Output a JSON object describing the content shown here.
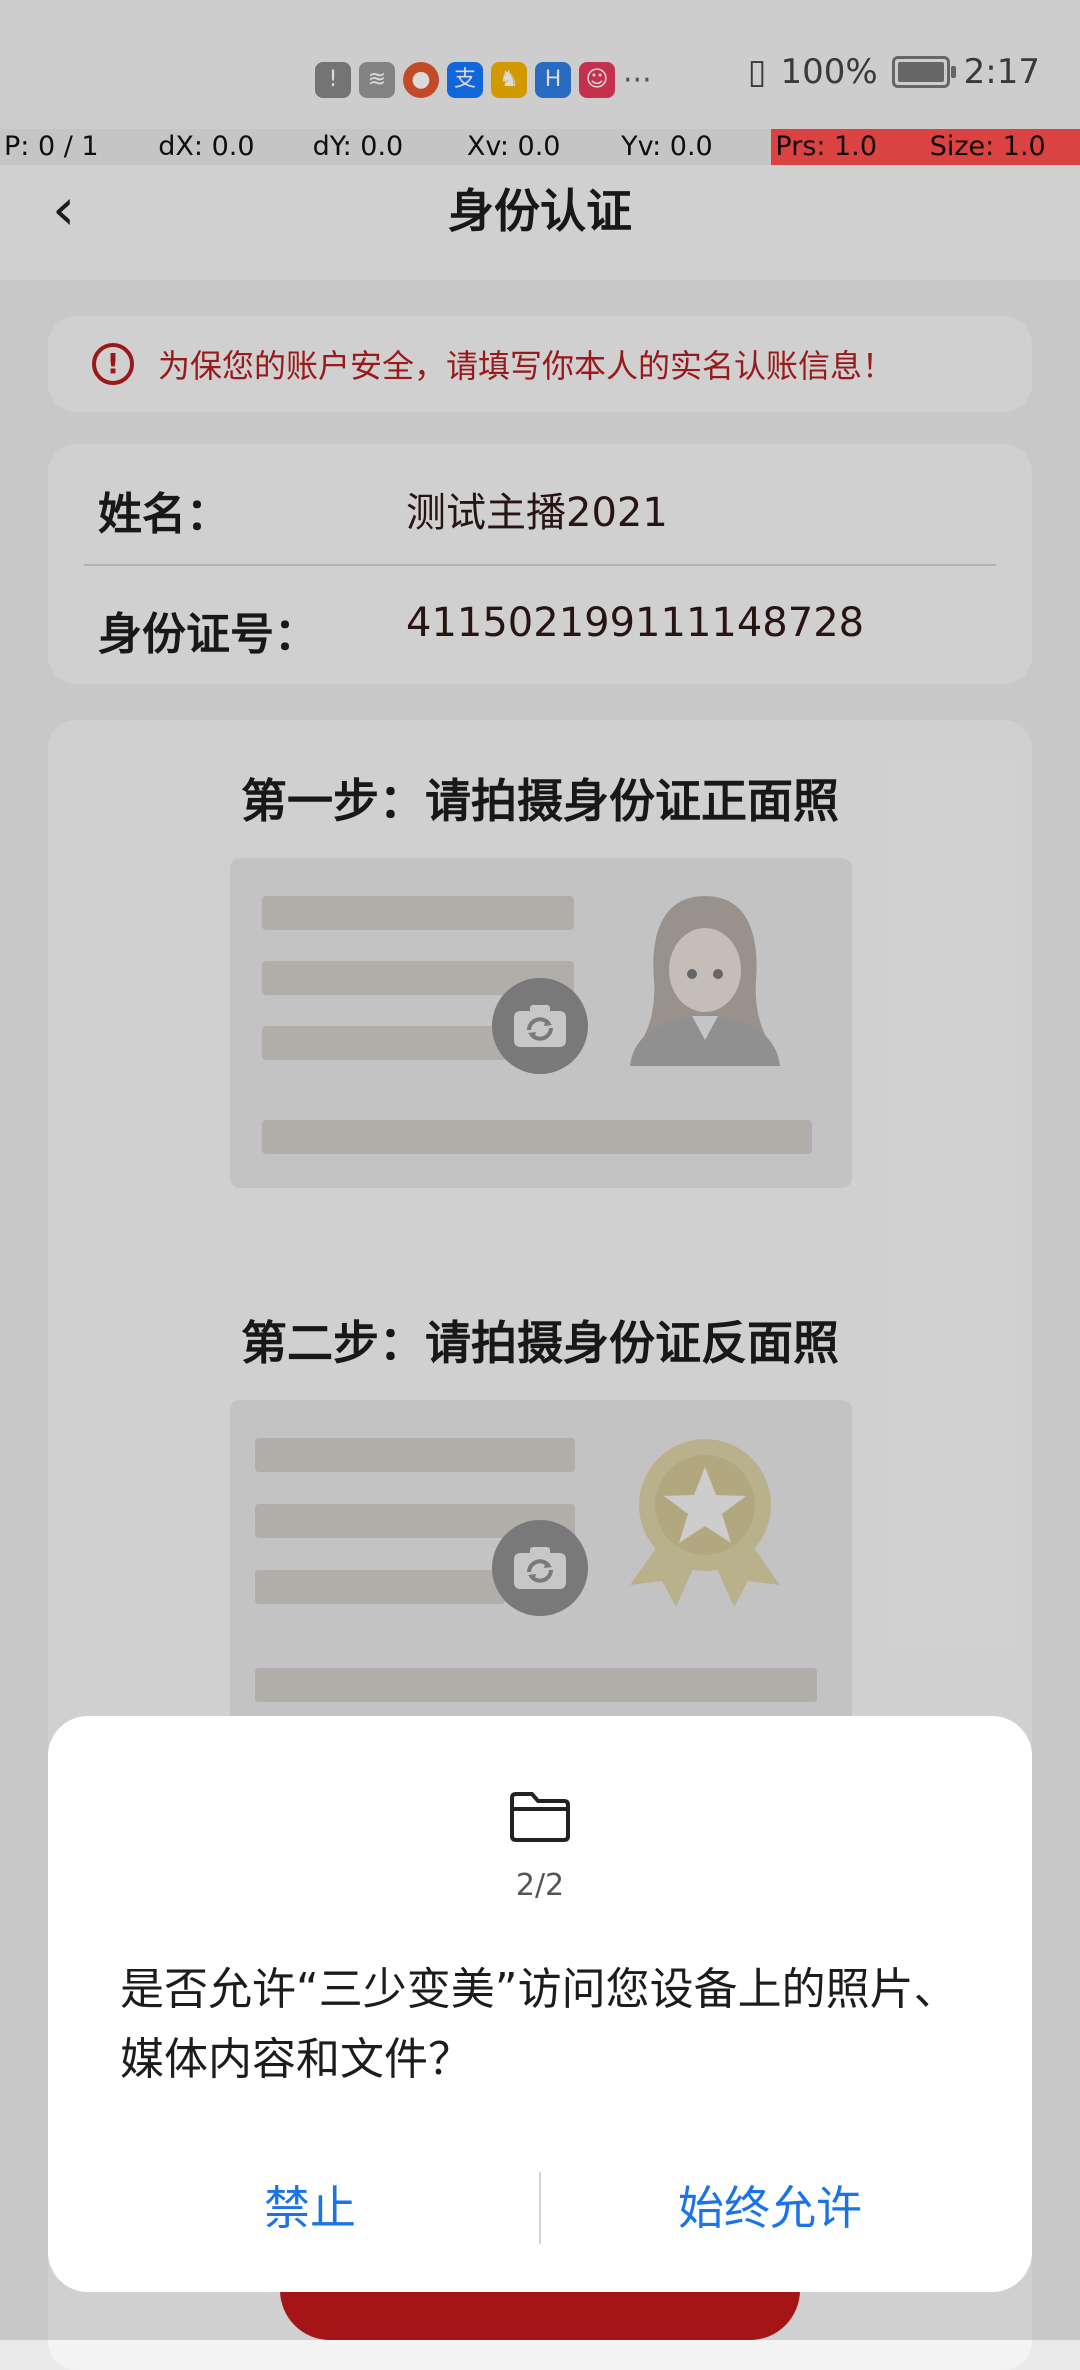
{
  "status_bar": {
    "battery": "100%",
    "time": "2:17",
    "more": "···"
  },
  "debug": {
    "p": "P: 0 / 1",
    "dx": "dX: 0.0",
    "dy": "dY: 0.0",
    "xv": "Xv: 0.0",
    "yv": "Yv: 0.0",
    "prs": "Prs: 1.0",
    "size": "Size: 1.0"
  },
  "header": {
    "title": "身份认证"
  },
  "notice": {
    "text": "为保您的账户安全，请填写你本人的实名认账信息！"
  },
  "info": {
    "name_label": "姓名：",
    "name_value": "测试主播2021",
    "id_label": "身份证号：",
    "id_value": "411502199111148728"
  },
  "steps": {
    "step1": "第一步：请拍摄身份证正面照",
    "step2": "第二步：请拍摄身份证反面照"
  },
  "dialog": {
    "counter": "2/2",
    "message": "是否允许“三少变美”访问您设备上的照片、媒体内容和文件？",
    "deny": "禁止",
    "allow": "始终允许"
  },
  "colors": {
    "accent_red": "#c0191b",
    "dialog_button": "#1a73e8",
    "debug_highlight": "#ff4d4d"
  }
}
